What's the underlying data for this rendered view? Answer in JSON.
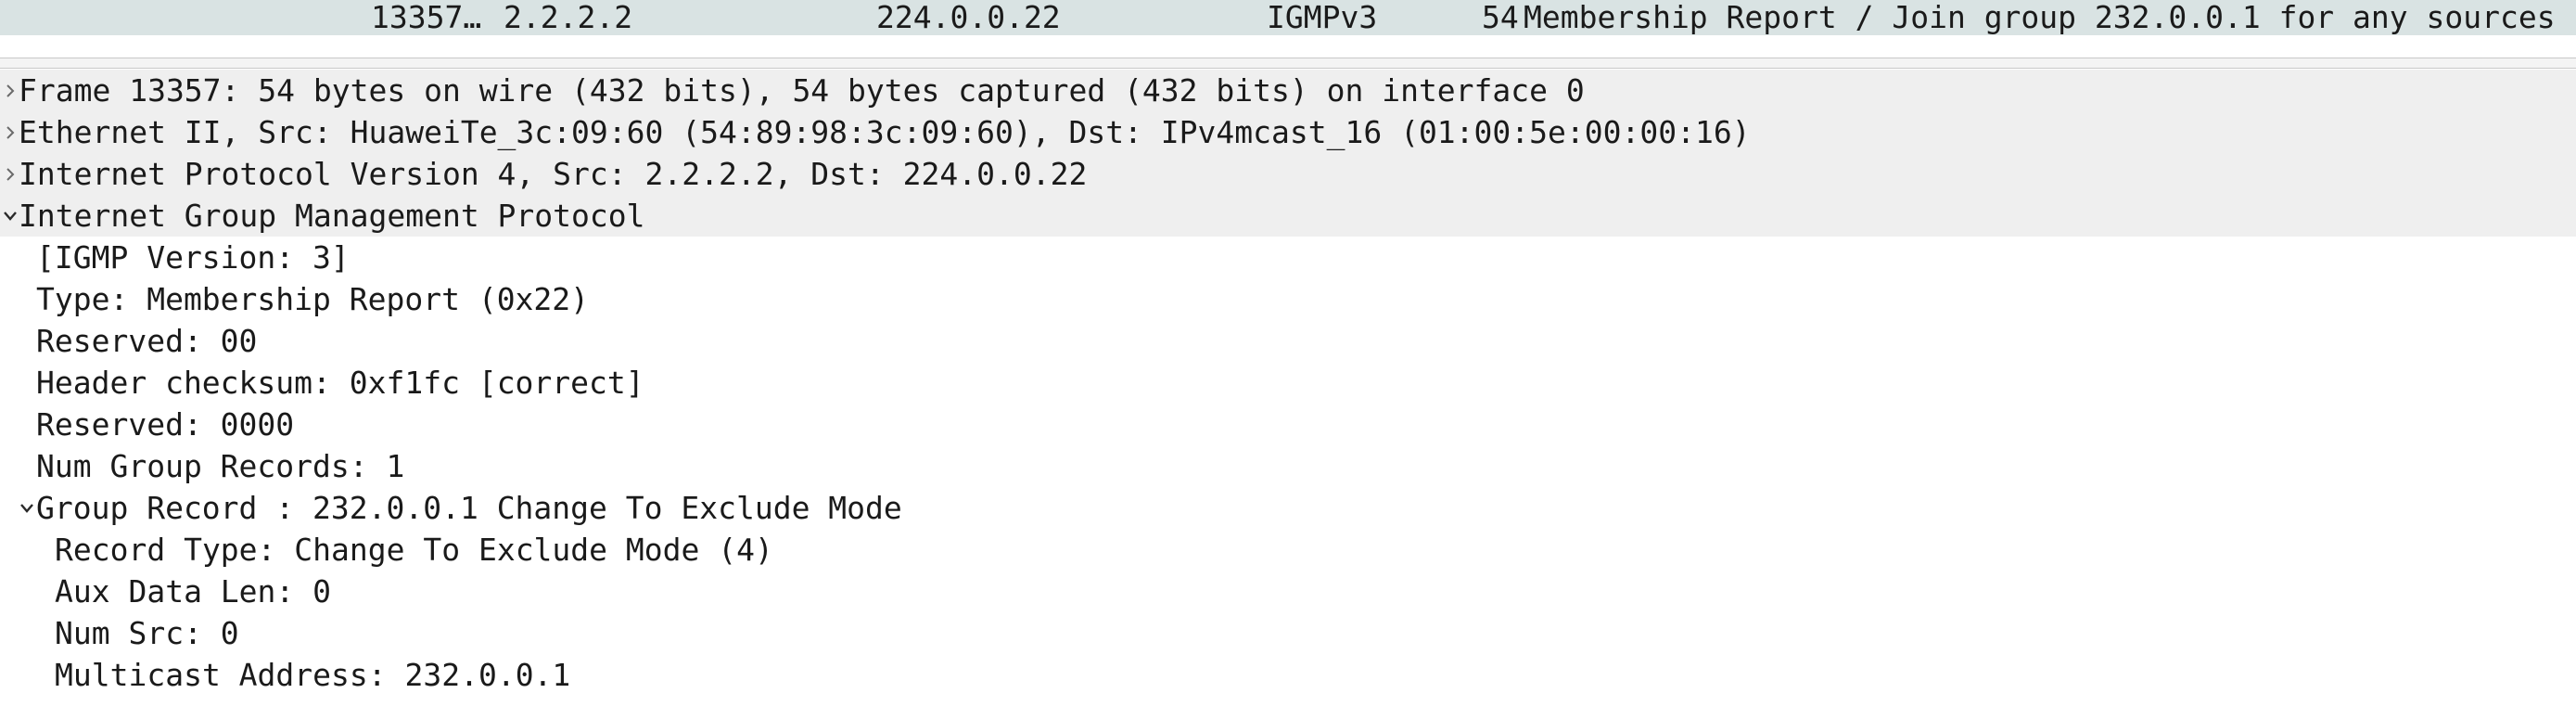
{
  "packet_list": {
    "selected_row": {
      "no": "13357…",
      "source": "2.2.2.2",
      "destination": "224.0.0.22",
      "protocol": "IGMPv3",
      "length": "54",
      "info": "Membership Report / Join group 232.0.0.1 for any sources"
    }
  },
  "details": {
    "frame": "Frame 13357: 54 bytes on wire (432 bits), 54 bytes captured (432 bits) on interface 0",
    "ethernet": "Ethernet II, Src: HuaweiTe_3c:09:60 (54:89:98:3c:09:60), Dst: IPv4mcast_16 (01:00:5e:00:00:16)",
    "ip": "Internet Protocol Version 4, Src: 2.2.2.2, Dst: 224.0.0.22",
    "igmp": {
      "title": "Internet Group Management Protocol",
      "version": "[IGMP Version: 3]",
      "type": "Type: Membership Report (0x22)",
      "reserved1": "Reserved: 00",
      "checksum": "Header checksum: 0xf1fc [correct]",
      "reserved2": "Reserved: 0000",
      "num_records": "Num Group Records: 1",
      "group_record": {
        "title": "Group Record : 232.0.0.1  Change To Exclude Mode",
        "record_type": "Record Type: Change To Exclude Mode (4)",
        "aux_len": "Aux Data Len: 0",
        "num_src": "Num Src: 0",
        "mcast_addr": "Multicast Address: 232.0.0.1"
      }
    }
  },
  "icons": {
    "collapsed": "chevron-right-icon",
    "expanded": "chevron-down-icon"
  },
  "colors": {
    "selected_row_bg": "#d9e3e3",
    "top_level_bg": "#efefef"
  }
}
